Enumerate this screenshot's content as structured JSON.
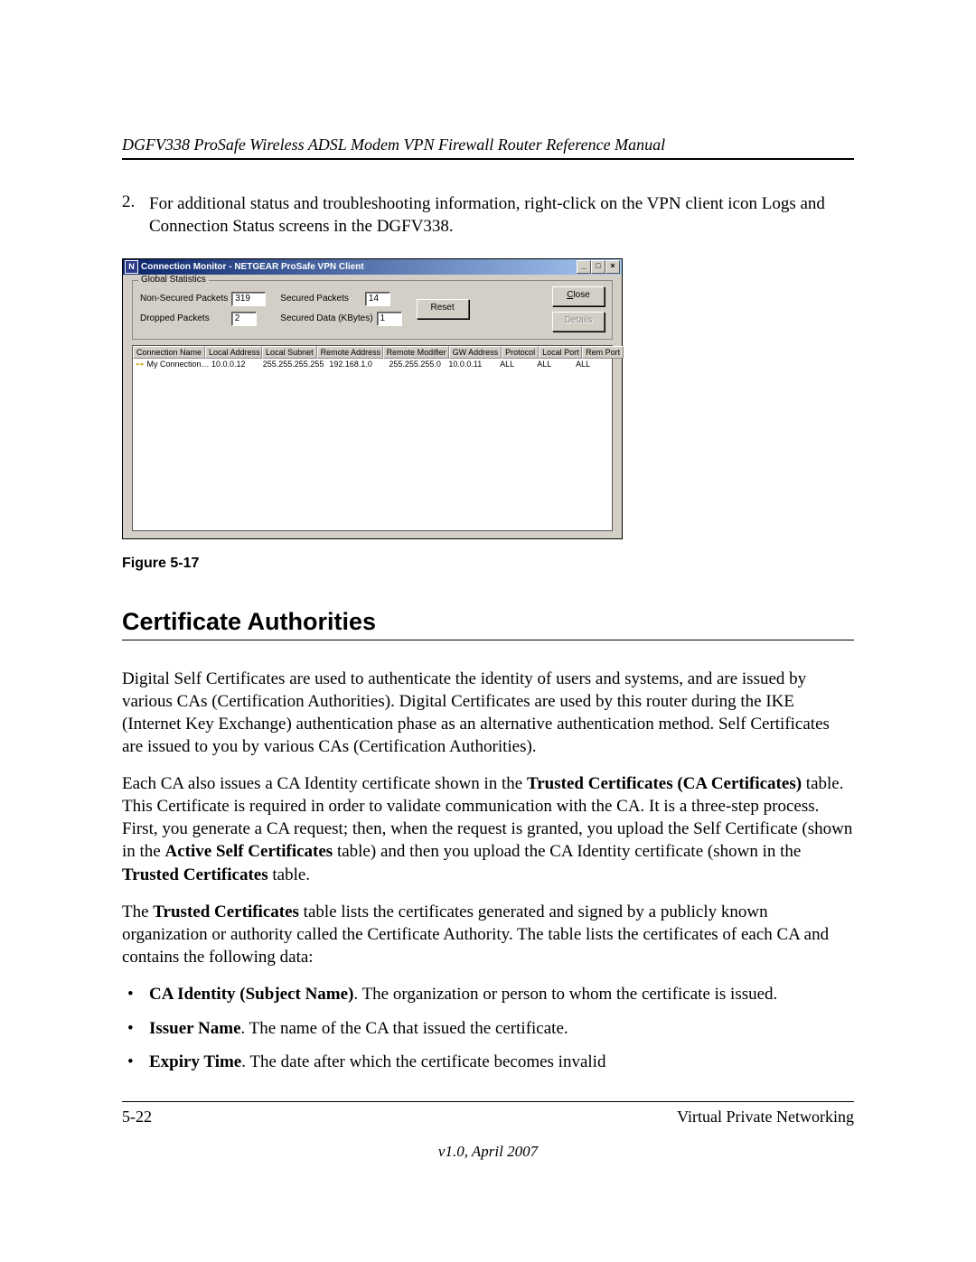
{
  "header": {
    "title": "DGFV338 ProSafe Wireless ADSL Modem VPN Firewall Router Reference Manual"
  },
  "step": {
    "num": "2.",
    "text": "For additional status and troubleshooting information, right-click on the VPN client icon Logs and Connection Status screens in the DGFV338."
  },
  "dialog": {
    "title": "Connection Monitor - NETGEAR ProSafe VPN Client",
    "win_icon": "N",
    "global_stats_label": "Global Statistics",
    "labels": {
      "non_secured": "Non-Secured Packets",
      "dropped": "Dropped Packets",
      "secured_pkts": "Secured Packets",
      "secured_data": "Secured Data (KBytes)"
    },
    "values": {
      "non_secured": "319",
      "dropped": "2",
      "secured_pkts": "14",
      "secured_data": "1"
    },
    "buttons": {
      "reset": "Reset",
      "close": "Close",
      "details": "Details"
    },
    "columns": {
      "cn": "Connection Name",
      "la": "Local Address",
      "ls": "Local Subnet",
      "ra": "Remote Address",
      "rm": "Remote Modifier",
      "gw": "GW Address",
      "pr": "Protocol",
      "lp": "Local Port",
      "rp": "Rem Port"
    },
    "row": {
      "cn": "My Connection…",
      "la": "10.0.0.12",
      "ls": "255.255.255.255",
      "ra": "192.168.1.0",
      "rm": "255.255.255.0",
      "gw": "10.0.0.11",
      "pr": "ALL",
      "lp": "ALL",
      "rp": "ALL"
    },
    "win_controls": {
      "min": "_",
      "max": "□",
      "close": "×"
    }
  },
  "figure_label": "Figure 5-17",
  "section_heading": "Certificate Authorities",
  "para1": "Digital Self Certificates are used to authenticate the identity of users and systems, and are issued by various CAs (Certification Authorities). Digital Certificates are used by this router during the IKE (Internet Key Exchange) authentication phase as an alternative authentication method. Self Certificates are issued to you by various CAs (Certification Authorities).",
  "para2": {
    "t1": "Each CA also issues a CA Identity certificate shown in the ",
    "b1": "Trusted Certificates (CA Certificates)",
    "t2": " table. This Certificate is required in order to validate communication with the CA. It is a three-step process. First, you generate a CA request; then, when the request is granted, you upload the Self Certificate (shown in the ",
    "b2": "Active Self Certificates",
    "t3": " table) and then you upload the CA Identity certificate (shown in the ",
    "b3": "Trusted Certificates",
    "t4": " table."
  },
  "para3": {
    "t1": "The ",
    "b1": "Trusted Certificates",
    "t2": " table lists the certificates generated and signed by a publicly known organization or authority called the Certificate Authority. The table lists the certificates of each CA and contains the following data:"
  },
  "bullets": {
    "i1b": "CA Identity (Subject Name)",
    "i1t": ". The organization or person to whom the certificate is issued.",
    "i2b": "Issuer Name",
    "i2t": ". The name of the CA that issued the certificate.",
    "i3b": "Expiry Time",
    "i3t": ". The date after which the certificate becomes invalid"
  },
  "footer": {
    "page": "5-22",
    "section": "Virtual Private Networking",
    "version": "v1.0, April 2007"
  }
}
